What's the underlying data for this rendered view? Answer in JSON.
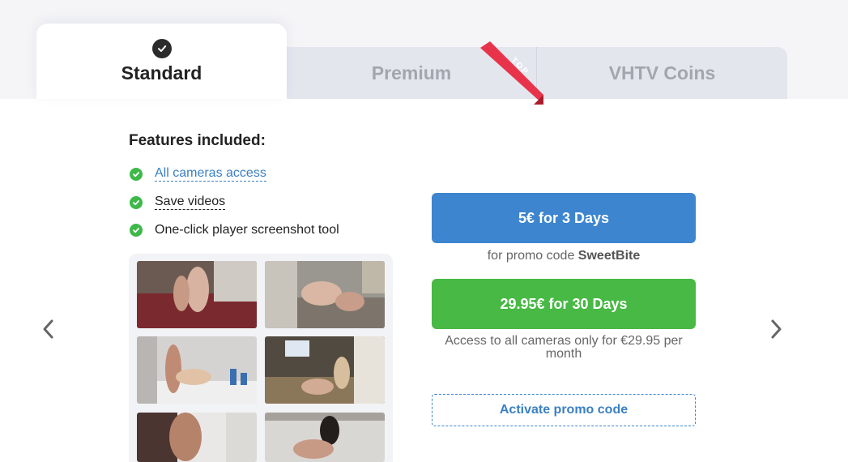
{
  "tabs": [
    {
      "label": "Standard",
      "active": true
    },
    {
      "label": "Premium",
      "ribbon": "TOP"
    },
    {
      "label": "VHTV Coins"
    }
  ],
  "features": {
    "title": "Features included:",
    "items": [
      "All cameras access",
      "Save videos",
      "One-click player screenshot tool"
    ]
  },
  "offers": {
    "primary_label": "5€ for 3 Days",
    "promo_prefix": "for promo code ",
    "promo_code": "SweetBite",
    "secondary_label": "29.95€ for 30 Days",
    "access_note": "Access to all cameras only for €29.95 per month",
    "activate_label": "Activate promo code"
  },
  "colors": {
    "accent_blue": "#3d85ce",
    "accent_green": "#47b944",
    "ribbon_red": "#e8344a",
    "check_green": "#3fb84a"
  },
  "icons": [
    "check-badge-icon",
    "check-icon",
    "chevron-left-icon",
    "chevron-right-icon"
  ],
  "gallery": {
    "thumbnail_count": 6
  }
}
